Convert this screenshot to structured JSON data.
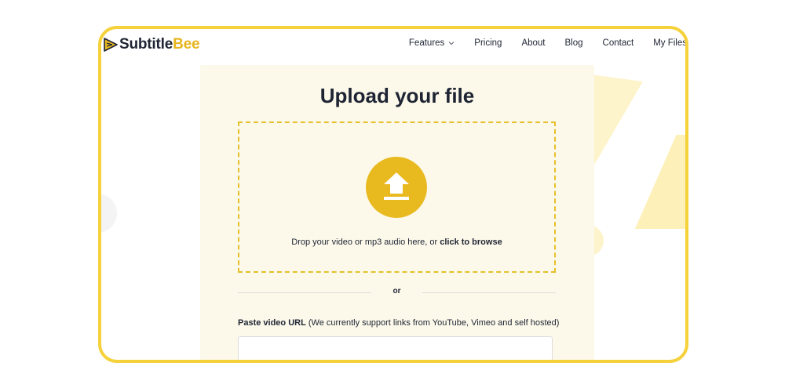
{
  "logo": {
    "part1": "Subtitle",
    "part2": "Bee"
  },
  "nav": {
    "features": "Features",
    "pricing": "Pricing",
    "about": "About",
    "blog": "Blog",
    "contact": "Contact",
    "my_files": "My Files"
  },
  "upload": {
    "title": "Upload your file",
    "drop_text": "Drop your video or mp3 audio here, or ",
    "browse_link": "click to browse",
    "divider": "or",
    "url_label": "Paste video URL",
    "url_note": " (We currently support links from YouTube, Vimeo and self hosted)",
    "url_value": "",
    "url_placeholder": ""
  },
  "colors": {
    "accent": "#e9b920",
    "frame_border": "#f5d23c",
    "text_dark": "#1e2433",
    "card_bg": "#fcf9ea"
  },
  "icons": {
    "logo": "play-triangle-icon",
    "features_caret": "chevron-down-icon",
    "upload": "upload-arrow-icon"
  }
}
